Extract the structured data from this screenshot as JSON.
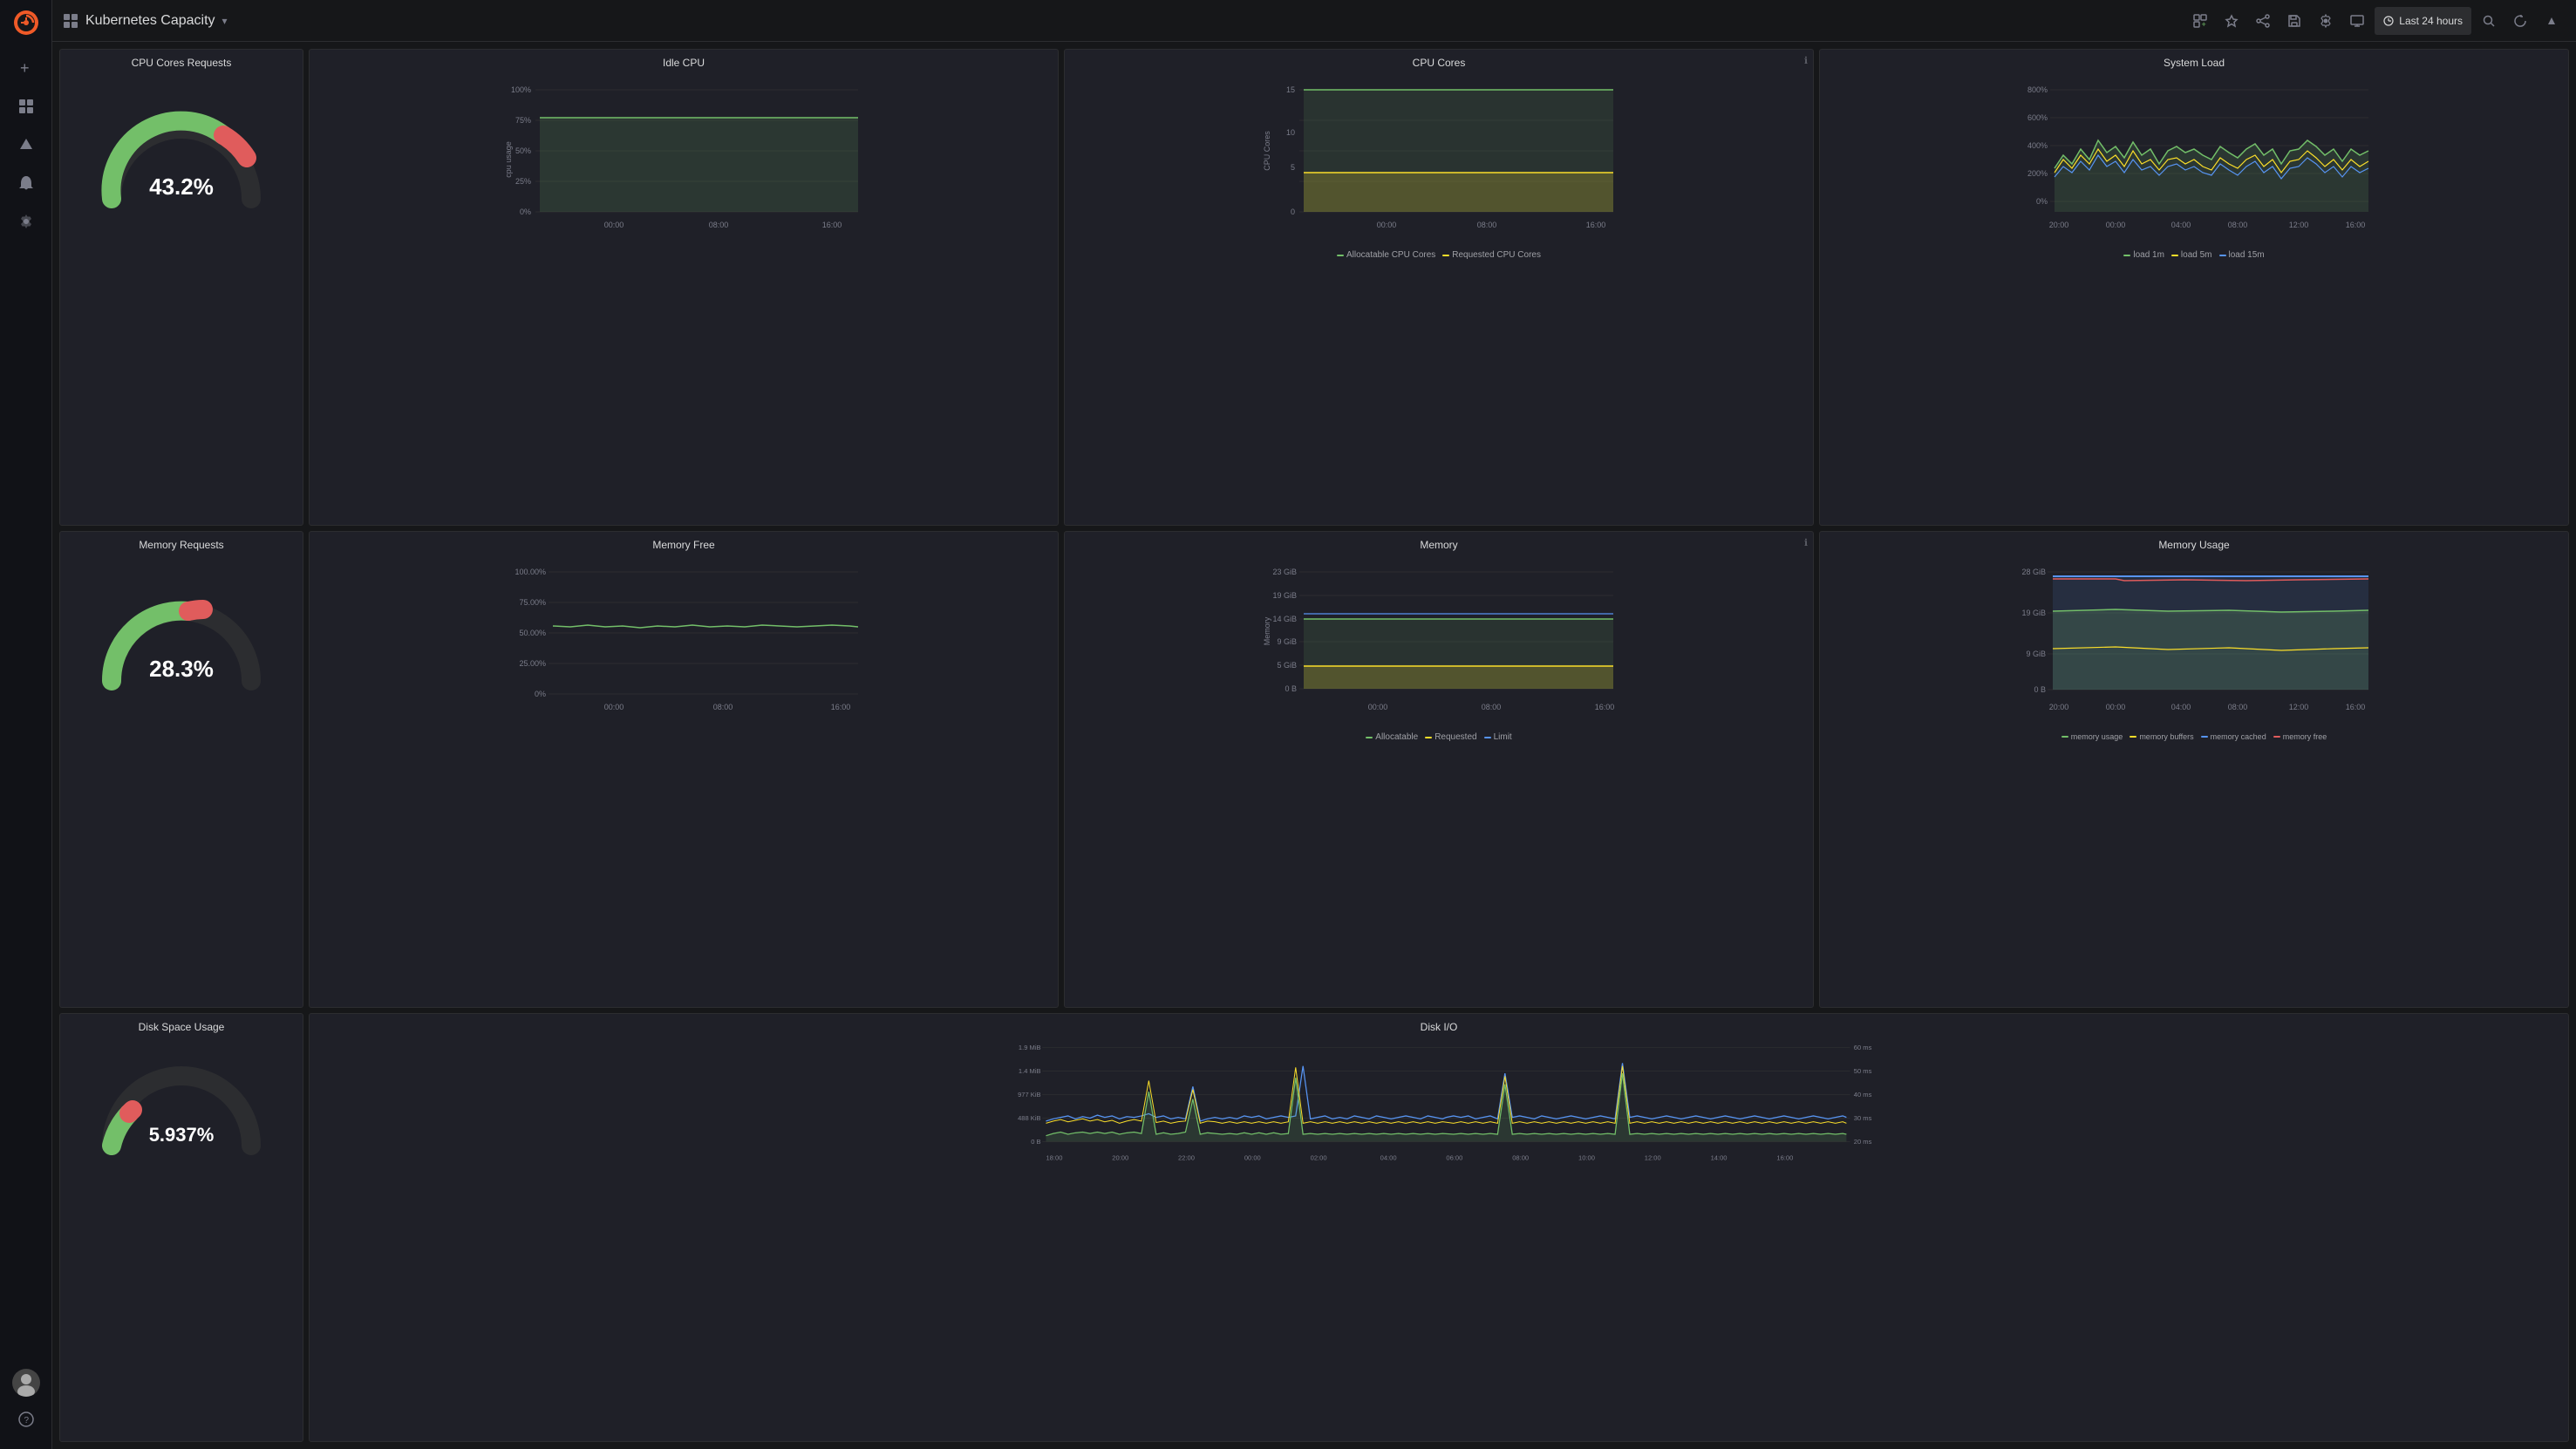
{
  "sidebar": {
    "logo_alt": "Grafana Logo",
    "items": [
      {
        "name": "add",
        "icon": "+",
        "label": "Add"
      },
      {
        "name": "apps",
        "icon": "⊞",
        "label": "Apps"
      },
      {
        "name": "explore",
        "icon": "✦",
        "label": "Explore"
      },
      {
        "name": "alerting",
        "icon": "🔔",
        "label": "Alerting"
      },
      {
        "name": "settings",
        "icon": "⚙",
        "label": "Settings"
      }
    ],
    "avatar_alt": "User Avatar"
  },
  "topbar": {
    "title": "Kubernetes Capacity",
    "dropdown_icon": "▾",
    "actions": {
      "chart_icon": "chart",
      "star_icon": "star",
      "share_icon": "share",
      "save_icon": "save",
      "settings_icon": "settings",
      "tv_icon": "tv",
      "time_range": "Last 24 hours",
      "search_icon": "search",
      "refresh_icon": "refresh",
      "more_icon": "more"
    }
  },
  "panels": {
    "cpu_cores_requests": {
      "title": "CPU Cores Requests",
      "value": "43.2%",
      "gauge_color_main": "#73bf69",
      "gauge_color_warn": "#e05c5c"
    },
    "idle_cpu": {
      "title": "Idle CPU",
      "y_labels": [
        "100%",
        "75%",
        "50%",
        "25%",
        "0%"
      ],
      "x_labels": [
        "00:00",
        "08:00",
        "16:00"
      ],
      "y_axis_label": "cpu usage"
    },
    "cpu_cores": {
      "title": "CPU Cores",
      "y_labels": [
        "15",
        "10",
        "5",
        "0"
      ],
      "x_labels": [
        "00:00",
        "08:00",
        "16:00"
      ],
      "y_axis_label": "CPU Cores",
      "legend": [
        {
          "label": "Allocatable CPU Cores",
          "color": "#73bf69"
        },
        {
          "label": "Requested CPU Cores",
          "color": "#fade2a"
        }
      ]
    },
    "system_load": {
      "title": "System Load",
      "y_labels": [
        "800%",
        "600%",
        "400%",
        "200%",
        "0%"
      ],
      "x_labels": [
        "20:00",
        "00:00",
        "04:00",
        "08:00",
        "12:00",
        "16:00"
      ],
      "legend": [
        {
          "label": "load 1m",
          "color": "#73bf69"
        },
        {
          "label": "load 5m",
          "color": "#fade2a"
        },
        {
          "label": "load 15m",
          "color": "#5794f2"
        }
      ]
    },
    "memory_requests": {
      "title": "Memory Requests",
      "value": "28.3%",
      "gauge_color_main": "#73bf69",
      "gauge_color_warn": "#e05c5c"
    },
    "memory_free": {
      "title": "Memory Free",
      "y_labels": [
        "100.00%",
        "75.00%",
        "50.00%",
        "25.00%",
        "0%"
      ],
      "x_labels": [
        "00:00",
        "08:00",
        "16:00"
      ]
    },
    "memory": {
      "title": "Memory",
      "y_labels": [
        "23 GiB",
        "19 GiB",
        "14 GiB",
        "9 GiB",
        "5 GiB",
        "0 B"
      ],
      "x_labels": [
        "00:00",
        "08:00",
        "16:00"
      ],
      "y_axis_label": "Memory",
      "legend": [
        {
          "label": "Allocatable",
          "color": "#73bf69"
        },
        {
          "label": "Requested",
          "color": "#fade2a"
        },
        {
          "label": "Limit",
          "color": "#5794f2"
        }
      ]
    },
    "memory_usage": {
      "title": "Memory Usage",
      "y_labels": [
        "28 GiB",
        "19 GiB",
        "9 GiB",
        "0 B"
      ],
      "x_labels": [
        "20:00",
        "00:00",
        "04:00",
        "08:00",
        "12:00",
        "16:00"
      ],
      "legend": [
        {
          "label": "memory usage",
          "color": "#73bf69"
        },
        {
          "label": "memory buffers",
          "color": "#fade2a"
        },
        {
          "label": "memory cached",
          "color": "#5794f2"
        },
        {
          "label": "memory free",
          "color": "#e05c5c"
        }
      ]
    },
    "disk_space": {
      "title": "Disk Space Usage",
      "value": "5.937%",
      "gauge_color_main": "#73bf69",
      "gauge_color_warn": "#e05c5c"
    },
    "disk_io": {
      "title": "Disk I/O",
      "y_labels_left": [
        "1.9 MiB",
        "1.4 MiB",
        "977 KiB",
        "488 KiB",
        "0 B"
      ],
      "y_labels_right": [
        "60 ms",
        "50 ms",
        "40 ms",
        "30 ms",
        "20 ms"
      ],
      "x_labels": [
        "18:00",
        "20:00",
        "22:00",
        "00:00",
        "02:00",
        "04:00",
        "06:00",
        "08:00",
        "10:00",
        "12:00",
        "14:00",
        "16:00"
      ]
    }
  }
}
